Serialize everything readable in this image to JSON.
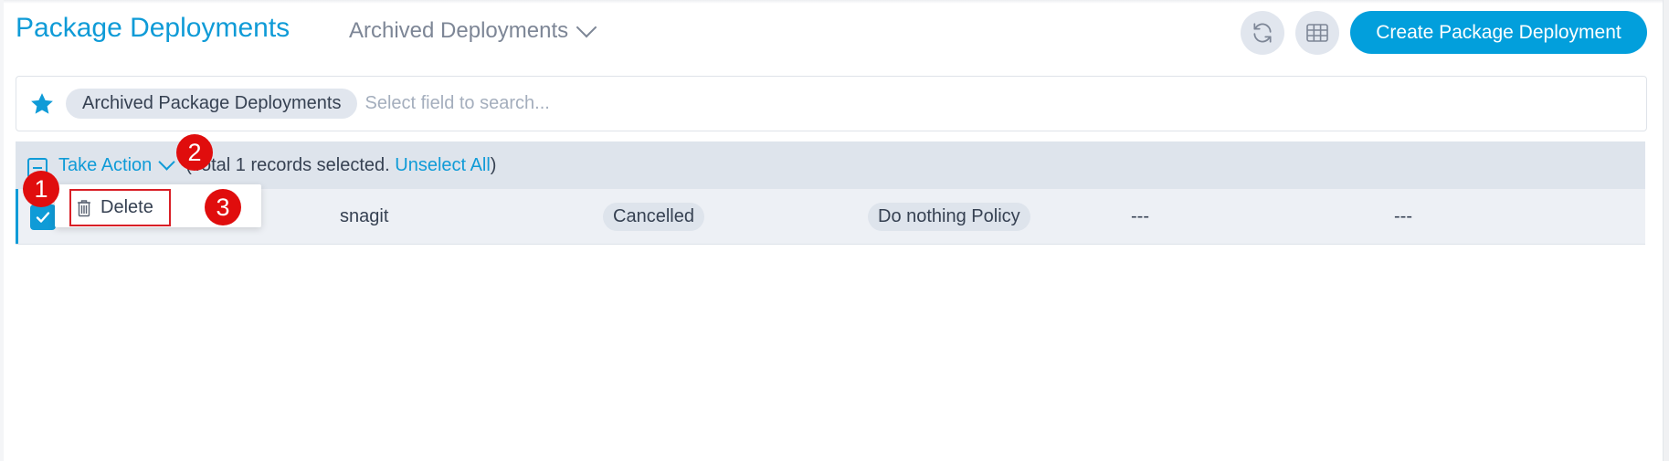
{
  "header": {
    "title": "Package Deployments",
    "view_selector": "Archived Deployments",
    "refresh_icon": "refresh-icon",
    "grid_icon": "table-grid-icon",
    "create_button": "Create Package Deployment"
  },
  "search": {
    "favorite_icon": "star-icon",
    "active_filter_chip": "Archived Package Deployments",
    "placeholder": "Select field to search..."
  },
  "bulk_bar": {
    "take_action_label": "Take Action",
    "selection_prefix": "(Total 1 records selected. ",
    "unselect_all": "Unselect All",
    "selection_suffix": ")"
  },
  "action_menu": {
    "items": [
      {
        "label": "Delete",
        "icon": "trash-icon"
      }
    ]
  },
  "rows": [
    {
      "checked": true,
      "name": "snagit",
      "status": "Cancelled",
      "policy": "Do nothing Policy",
      "col5": "---",
      "col6": "---"
    }
  ],
  "annotations": [
    "1",
    "2",
    "3"
  ],
  "colors": {
    "accent": "#0f9bd7",
    "create_button": "#029fdc",
    "annotation_red": "#e00d0d"
  }
}
